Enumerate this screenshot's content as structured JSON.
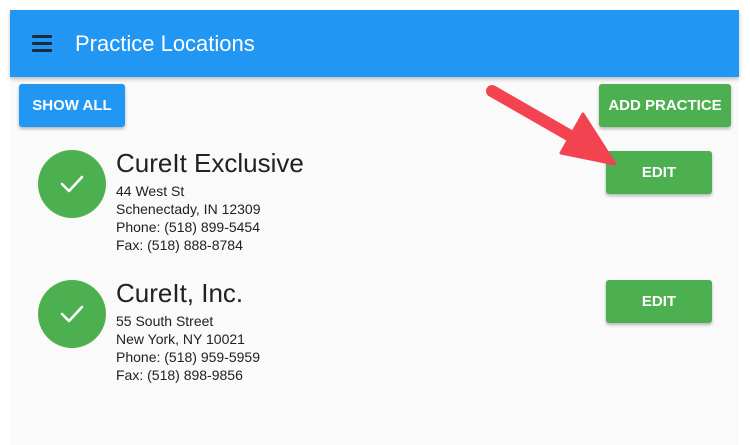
{
  "app_bar": {
    "title": "Practice Locations",
    "menu_icon": "hamburger-menu-icon",
    "color": "#2196f3"
  },
  "toolbar": {
    "show_all_label": "SHOW ALL",
    "add_practice_label": "ADD PRACTICE"
  },
  "locations": [
    {
      "name": "CureIt Exclusive",
      "address": "44 West St",
      "city_line": "Schenectady, IN 12309",
      "phone": "Phone: (518) 899-5454",
      "fax": "Fax: (518) 888-8784",
      "status_icon": "check-icon",
      "edit_label": "EDIT"
    },
    {
      "name": "CureIt, Inc.",
      "address": "55 South Street",
      "city_line": "New York, NY 10021",
      "phone": "Phone: (518) 959-5959",
      "fax": "Fax: (518) 898-9856",
      "status_icon": "check-icon",
      "edit_label": "EDIT"
    }
  ],
  "annotation": {
    "icon": "red-arrow-icon",
    "color": "#f44350"
  },
  "colors": {
    "primary": "#2196f3",
    "success": "#4caf50",
    "background": "#fafafa",
    "text": "#212121"
  }
}
